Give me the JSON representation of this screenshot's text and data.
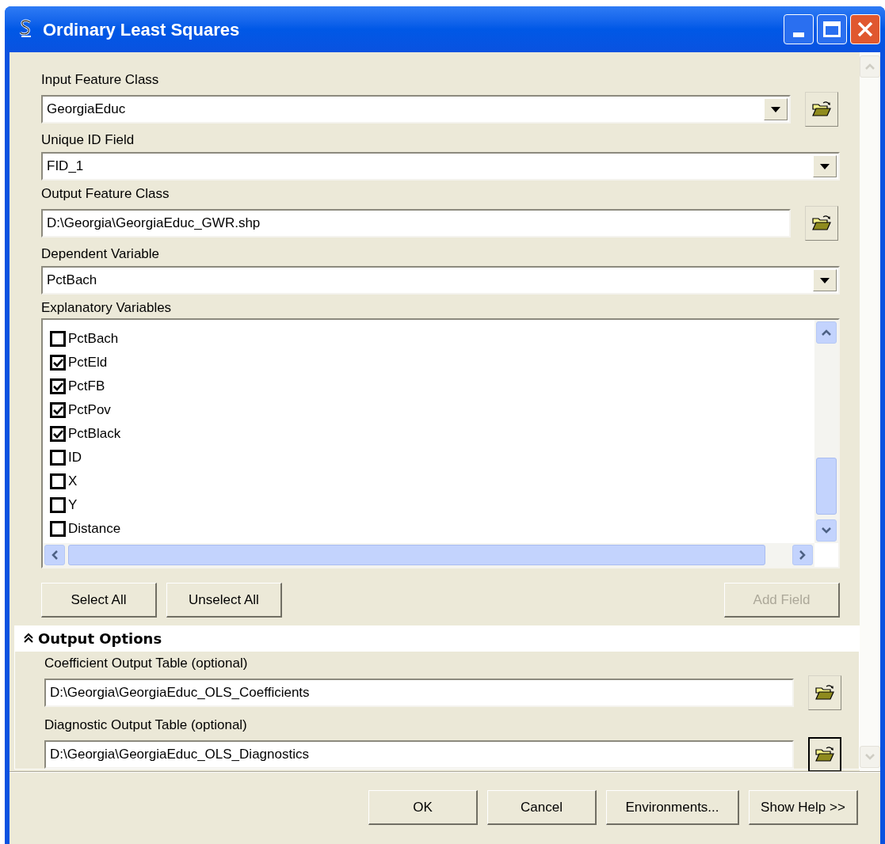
{
  "window": {
    "title": "Ordinary Least Squares"
  },
  "parameters": [
    {
      "kind": "combo_browse",
      "label": "Input Feature Class",
      "value": "GeorgiaEduc"
    },
    {
      "kind": "combo",
      "label": "Unique ID Field",
      "value": "FID_1"
    },
    {
      "kind": "text_browse",
      "label": "Output Feature Class",
      "value": "D:\\Georgia\\GeorgiaEduc_GWR.shp"
    },
    {
      "kind": "combo",
      "label": "Dependent Variable",
      "value": "PctBach"
    }
  ],
  "explanatory_variables": {
    "label": "Explanatory Variables",
    "items": [
      {
        "label": "PctBach",
        "checked": false
      },
      {
        "label": "PctEld",
        "checked": true
      },
      {
        "label": "PctFB",
        "checked": true
      },
      {
        "label": "PctPov",
        "checked": true
      },
      {
        "label": "PctBlack",
        "checked": true
      },
      {
        "label": "ID",
        "checked": false
      },
      {
        "label": "X",
        "checked": false
      },
      {
        "label": "Y",
        "checked": false
      },
      {
        "label": "Distance",
        "checked": false
      }
    ]
  },
  "list_buttons": [
    {
      "label": "Select All",
      "disabled": false
    },
    {
      "label": "Unselect All",
      "disabled": false
    },
    {
      "label": "Add Field",
      "disabled": true
    }
  ],
  "output_options": {
    "title": "Output Options",
    "expanded": true,
    "parameters": [
      {
        "label": "Coefficient Output Table (optional)",
        "value": "D:\\Georgia\\GeorgiaEduc_OLS_Coefficients",
        "focused": false
      },
      {
        "label": "Diagnostic Output Table (optional)",
        "value": "D:\\Georgia\\GeorgiaEduc_OLS_Diagnostics",
        "focused": true
      }
    ]
  },
  "buttons": [
    "OK",
    "Cancel",
    "Environments...",
    "Show Help >>"
  ]
}
